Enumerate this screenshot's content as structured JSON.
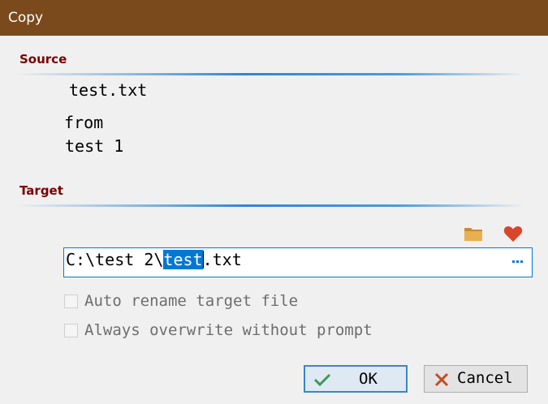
{
  "window": {
    "title": "Copy"
  },
  "source": {
    "heading": "Source",
    "file_name": "test.txt",
    "from_label": "from",
    "folder": "test 1"
  },
  "target": {
    "heading": "Target",
    "path_before": "C:\\test 2\\",
    "path_selected": "test",
    "path_after": ".txt",
    "browse_icon": "folder-icon",
    "favorites_icon": "heart-icon"
  },
  "options": {
    "auto_rename": {
      "label": "Auto rename target file",
      "checked": false
    },
    "always_overwrite": {
      "label": "Always overwrite without prompt",
      "checked": false
    }
  },
  "buttons": {
    "ok_label": "OK",
    "cancel_label": "Cancel"
  },
  "colors": {
    "titlebar": "#7a4a1c",
    "heading": "#7a0000",
    "accent": "#0078d7",
    "heart": "#d9472b",
    "folder": "#e0a94a"
  }
}
